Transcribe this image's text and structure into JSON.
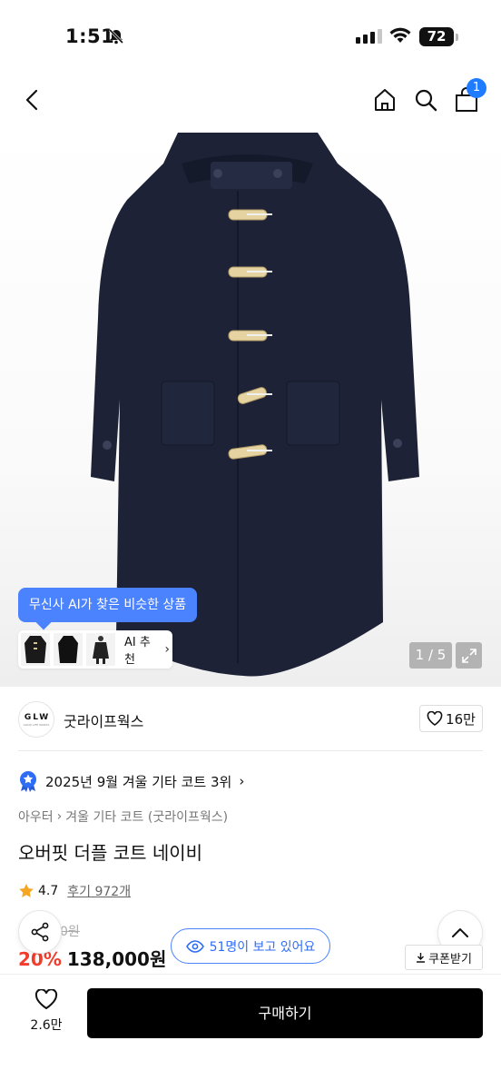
{
  "status": {
    "time": "1:51",
    "battery": "72"
  },
  "header": {
    "cart_count": "1"
  },
  "gallery": {
    "ai_tooltip": "무신사 AI가 찾은 비슷한 상품",
    "ai_link_label": "AI 추천",
    "page_indicator": "1 / 5"
  },
  "brand": {
    "name": "굿라이프웍스",
    "logo_text": "GLW",
    "logo_subtext": "GOOD LIFE WORKS",
    "likes": "16만"
  },
  "rank": {
    "text": "2025년 9월 겨울 기타 코트 3위"
  },
  "breadcrumb": {
    "items": [
      "아우터",
      "겨울 기타 코트 (굿라이프웍스)"
    ]
  },
  "product": {
    "title": "오버핏 더플 코트 네이비",
    "rating": "4.7",
    "reviews": "후기 972개",
    "original_price": "0원",
    "discount": "20%",
    "price": "138,000원"
  },
  "viewers": {
    "text": "51명이 보고 있어요"
  },
  "coupon": {
    "label": "쿠폰받기"
  },
  "bottom": {
    "wish_count": "2.6만",
    "buy_label": "구매하기"
  },
  "colors": {
    "accent_blue": "#4b83ff",
    "discount_red": "#f23c2c",
    "coat_navy": "#1d2236"
  },
  "icons": [
    "back-icon",
    "home-icon",
    "search-icon",
    "cart-icon",
    "expand-icon",
    "heart-icon",
    "share-icon",
    "eye-icon",
    "chevron-up-icon",
    "download-icon",
    "rank-badge-icon",
    "star-icon"
  ]
}
